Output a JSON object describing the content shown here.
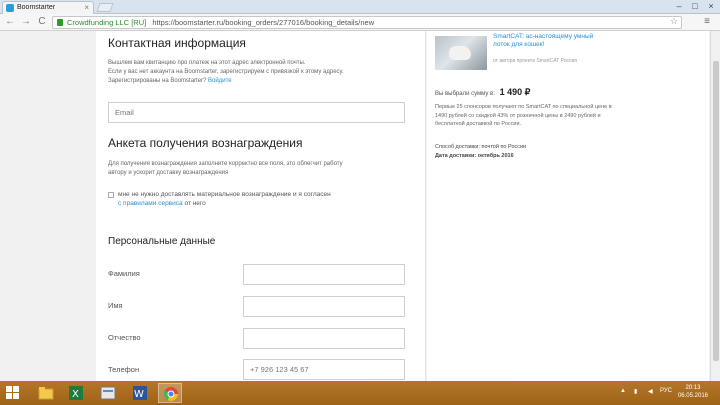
{
  "browser": {
    "tab_title": "Boomstarter",
    "tab_close": "×",
    "omnibox_ev": "Crowdfunding LLC [RU]",
    "omnibox_url": "https://boomstarter.ru/booking_orders/277016/booking_details/new",
    "star": "☆",
    "menu": "≡",
    "back": "←",
    "forward": "→",
    "reload": "C",
    "win_min": "–",
    "win_max": "□",
    "win_close": "×"
  },
  "contact": {
    "heading": "Контактная информация",
    "desc_line1": "Вышлем вам квитанцию про платеж на этот адрес электронной почты.",
    "desc_line2": "Если у вас нет аккаунта на Boomstarter, зарегистрируем с привязкой к этому адресу.",
    "desc_line3": "Зарегистрированы на Boomstarter?",
    "login_link": "Войдите",
    "email_placeholder": "Email"
  },
  "questionnaire": {
    "heading": "Анкета получения вознаграждения",
    "desc_line1": "Для получения вознаграждения заполните корректно все поля, это облегчит работу",
    "desc_line2": "автору и ускорит доставку вознаграждения",
    "checkbox_text": "мне не нужно доставлять материальное вознаграждение и я согласен",
    "checkbox_link": "с правилами сервиса",
    "checkbox_tail": "от него"
  },
  "personal": {
    "heading": "Персональные данные",
    "surname_label": "Фамилия",
    "name_label": "Имя",
    "patronymic_label": "Отчество",
    "phone_label": "Телефон",
    "phone_placeholder": "+7 926 123 45 67"
  },
  "reward": {
    "title": "SmartCAT: ас-настоящему умный лоток для кошек!",
    "meta": "от автора проекта SmartCAT Россия",
    "sum_label": "Вы выбрали сумму в:",
    "sum_value": "1 490 ₽",
    "description": "Первые 25 спонсоров получают по SmartCAT по специальной цене в 1490 рублей со скидкой 43% от розничной цены в 2490 рублей и бесплатной доставкой по России.",
    "delivery": "Способ доставки: почтой по России",
    "delivery_date": "Дата доставки: октябрь 2016"
  },
  "taskbar": {
    "lang": "РУС",
    "time": "20:13",
    "date": "06.05.2016"
  },
  "colors": {
    "accent": "#2a8fd0",
    "taskbar": "#a86a1c",
    "ev_green": "#2c8a2c"
  }
}
